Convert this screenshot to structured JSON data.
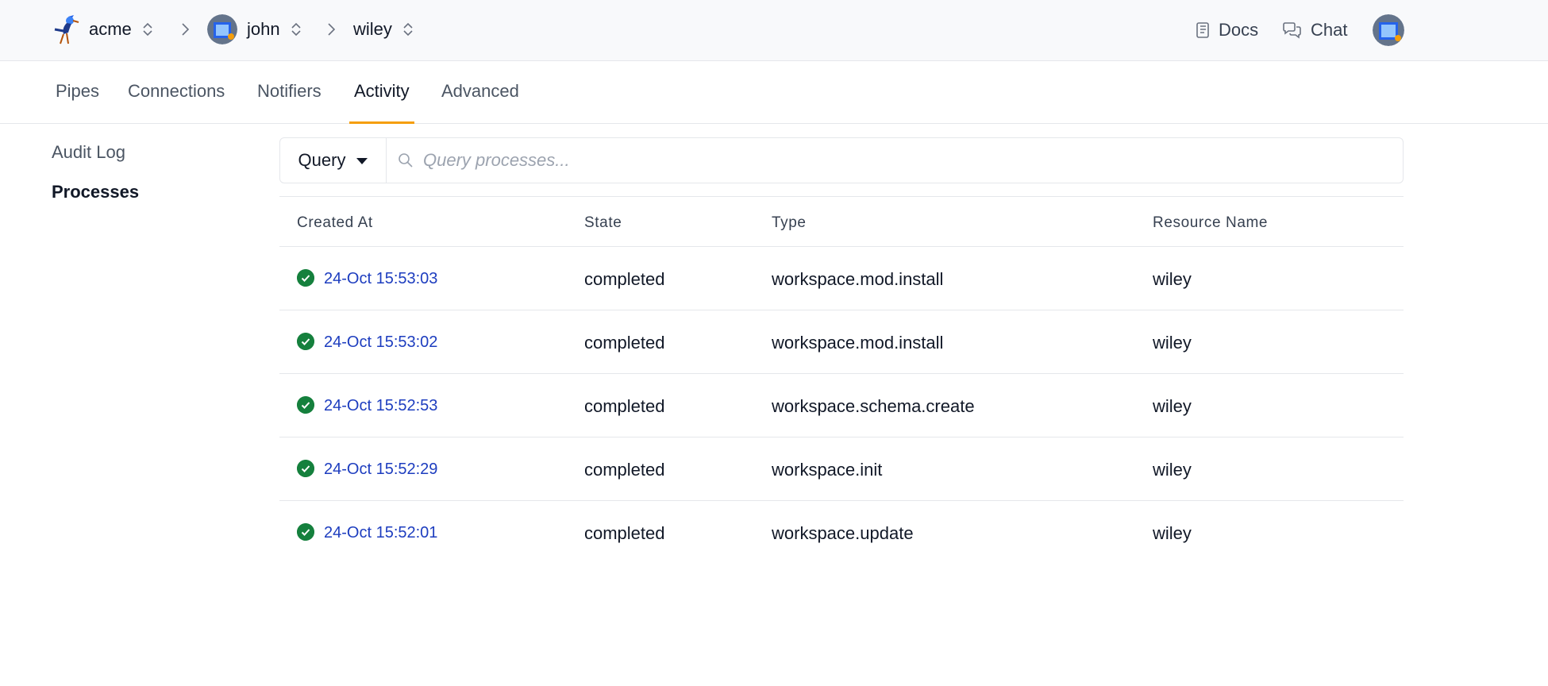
{
  "breadcrumb": {
    "org": "acme",
    "user": "john",
    "workspace": "wiley"
  },
  "header_links": {
    "docs": "Docs",
    "chat": "Chat"
  },
  "tabs": [
    {
      "label": "Pipes"
    },
    {
      "label": "Connections"
    },
    {
      "label": "Notifiers"
    },
    {
      "label": "Activity",
      "active": true
    },
    {
      "label": "Advanced"
    }
  ],
  "side_nav": [
    {
      "label": "Audit Log"
    },
    {
      "label": "Processes",
      "active": true
    }
  ],
  "query": {
    "button_label": "Query",
    "placeholder": "Query processes..."
  },
  "table": {
    "columns": [
      "Created At",
      "State",
      "Type",
      "Resource Name"
    ],
    "rows": [
      {
        "created_at": "24-Oct 15:53:03",
        "state": "completed",
        "type": "workspace.mod.install",
        "resource": "wiley"
      },
      {
        "created_at": "24-Oct 15:53:02",
        "state": "completed",
        "type": "workspace.mod.install",
        "resource": "wiley"
      },
      {
        "created_at": "24-Oct 15:52:53",
        "state": "completed",
        "type": "workspace.schema.create",
        "resource": "wiley"
      },
      {
        "created_at": "24-Oct 15:52:29",
        "state": "completed",
        "type": "workspace.init",
        "resource": "wiley"
      },
      {
        "created_at": "24-Oct 15:52:01",
        "state": "completed",
        "type": "workspace.update",
        "resource": "wiley"
      }
    ]
  },
  "icons": {
    "status": "check-circle-icon",
    "search": "search-icon",
    "docs": "book-icon",
    "chat": "chat-bubbles-icon"
  },
  "colors": {
    "accent": "#f59e0b",
    "link": "#1d3dbf",
    "success": "#15803d"
  }
}
